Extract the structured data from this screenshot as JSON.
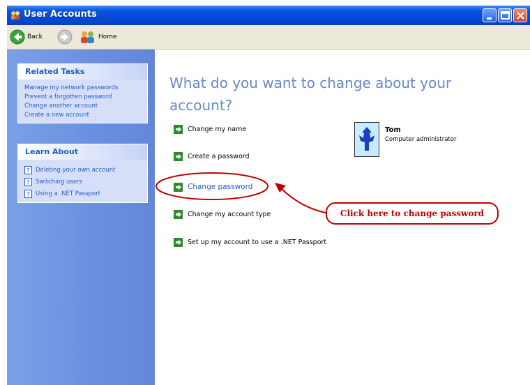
{
  "window": {
    "title": "User Accounts"
  },
  "toolbar": {
    "back_label": "Back",
    "home_label": "Home"
  },
  "sidebar": {
    "related_tasks": {
      "title": "Related Tasks",
      "items": [
        "Manage my network passwords",
        "Prevent a forgotten password",
        "Change another account",
        "Create a new account"
      ]
    },
    "learn_about": {
      "title": "Learn About",
      "items": [
        "Deleting your own account",
        "Switching users",
        "Using a .NET Passport"
      ]
    }
  },
  "main": {
    "heading": "What do you want to change about your account?",
    "options": [
      "Change my name",
      "Create a password",
      "Change password",
      "Change my account type",
      "Set up my account to use a .NET Passport"
    ]
  },
  "user": {
    "name": "Tom",
    "role": "Computer administrator"
  },
  "annotation": {
    "callout_text": "Click here to change password"
  },
  "colors": {
    "title_blue": "#0049d6",
    "task_link": "#215dc6",
    "heading": "#6787c8",
    "annotation_red": "#c00000",
    "arrow_green": "#2c8a2c"
  },
  "icons": [
    "user-accounts-icon",
    "minimize-icon",
    "maximize-icon",
    "close-icon",
    "back-icon",
    "forward-icon",
    "home-icon",
    "help-icon",
    "green-arrow-icon"
  ]
}
